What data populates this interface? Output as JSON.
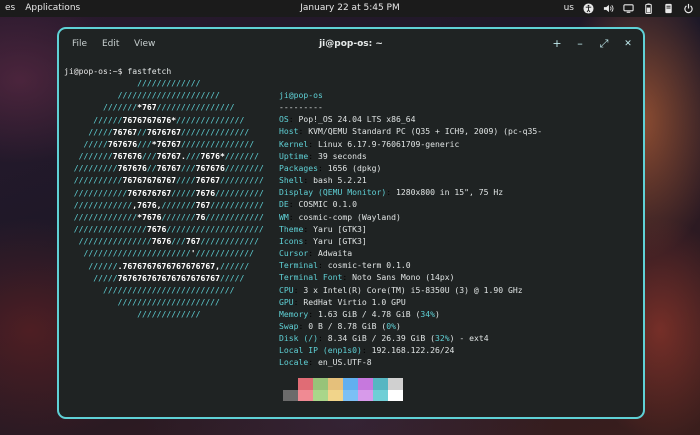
{
  "topbar": {
    "workspaces_label": "es",
    "applications_label": "Applications",
    "clock": "January 22 at 5:45 PM",
    "keyboard_layout": "us",
    "icons": [
      "accessibility-icon",
      "volume-icon",
      "network-icon",
      "battery-icon",
      "notifications-icon",
      "power-icon"
    ]
  },
  "window": {
    "title": "ji@pop-os: ~",
    "menu": {
      "file": "File",
      "edit": "Edit",
      "view": "View"
    },
    "controls": {
      "new_tab": "+",
      "minimize": "–",
      "maximize": "⤢",
      "close": "✕"
    }
  },
  "terminal": {
    "prompt": "ji@pop-os:~$",
    "command": " fastfetch",
    "logo": [
      "               /////////////",
      "           /////////////////////",
      "        ///////*767////////////////",
      "      //////7676767676*//////////////",
      "     /////76767//7676767//////////////",
      "    /////767676///*76767///////////////",
      "   ///////767676///76767.///7676*///////",
      "  /////////767676//76767///767676////////",
      "  //////////76767676767////76767/////////",
      "  ///////////767676767/////7676//////////",
      "  ////////////,7676,///////767///////////",
      "  /////////////*7676///////76////////////",
      "  ///////////////7676////////////////////",
      "   ///////////////7676///767////////////",
      "    //////////////////////'////////////",
      "     //////.7676767676767676767,//////",
      "      /////767676767676767676767/////",
      "        ///////////////////////////",
      "           /////////////////////",
      "               /////////////"
    ],
    "user_host": "ji@pop-os",
    "separator": "---------",
    "info": [
      {
        "key": "OS",
        "value": "Pop!_OS 24.04 LTS x86_64"
      },
      {
        "key": "Host",
        "value": "KVM/QEMU Standard PC (Q35 + ICH9, 2009) (pc-q35-"
      },
      {
        "key": "Kernel",
        "value": "Linux 6.17.9-76061709-generic"
      },
      {
        "key": "Uptime",
        "value": "39 seconds"
      },
      {
        "key": "Packages",
        "value": "1656 (dpkg)"
      },
      {
        "key": "Shell",
        "value": "bash 5.2.21"
      },
      {
        "key": "Display (QEMU Monitor)",
        "value": "1280x800 in 15\", 75 Hz"
      },
      {
        "key": "DE",
        "value": "COSMIC 0.1.0"
      },
      {
        "key": "WM",
        "value": "cosmic-comp (Wayland)"
      },
      {
        "key": "Theme",
        "value": "Yaru [GTK3]"
      },
      {
        "key": "Icons",
        "value": "Yaru [GTK3]"
      },
      {
        "key": "Cursor",
        "value": "Adwaita"
      },
      {
        "key": "Terminal",
        "value": "cosmic-term 0.1.0"
      },
      {
        "key": "Terminal Font",
        "value": "Noto Sans Mono (14px)"
      },
      {
        "key": "CPU",
        "value": "3 x Intel(R) Core(TM) i5-8350U (3) @ 1.90 GHz"
      },
      {
        "key": "GPU",
        "value": "RedHat Virtio 1.0 GPU"
      },
      {
        "key": "Memory",
        "value": "1.63 GiB / 4.78 GiB (34%)"
      },
      {
        "key": "Swap",
        "value": "0 B / 8.78 GiB (0%)"
      },
      {
        "key": "Disk (/)",
        "value": "8.34 GiB / 26.39 GiB (32%) - ext4"
      },
      {
        "key": "Local IP (enp1s0)",
        "value": "192.168.122.26/24"
      },
      {
        "key": "Locale",
        "value": "en_US.UTF-8"
      }
    ],
    "palette_top": [
      "#1f2323",
      "#e06c75",
      "#98c379",
      "#e5c07b",
      "#61afef",
      "#c678dd",
      "#56b6c2",
      "#d0d0d0"
    ],
    "palette_bottom": [
      "#6b6b6b",
      "#f08a93",
      "#a9d68a",
      "#f1d48a",
      "#7cc0f5",
      "#d79aea",
      "#6fcfd6",
      "#ffffff"
    ]
  },
  "colors": {
    "accent": "#5fd1d6",
    "window_bg": "#1f2323",
    "topbar_bg": "#1b1b1b"
  }
}
